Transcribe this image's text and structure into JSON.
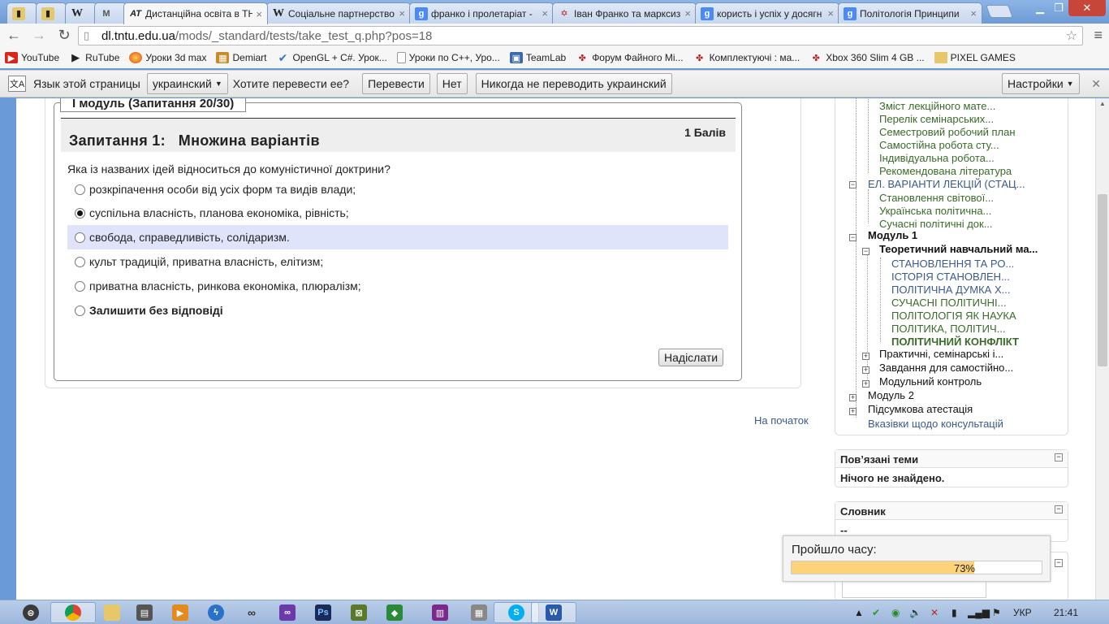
{
  "tabs": [
    {
      "label": "",
      "icon": "folder-icon",
      "color": "#d8b44a"
    },
    {
      "label": "",
      "icon": "folder-icon",
      "color": "#d8b44a"
    },
    {
      "label": "W",
      "icon": "wikipedia-icon",
      "color": "#ffffff"
    },
    {
      "label": "M",
      "icon": "moodle-icon",
      "color": "#ffffff"
    },
    {
      "label": "Дистанційна освіта в ТН",
      "icon": "at-icon",
      "color": "#ffffff",
      "active": true
    },
    {
      "label": "Соціальне партнерство",
      "icon": "wikipedia-icon",
      "color": "#ffffff"
    },
    {
      "label": "франко і пролетаріат -",
      "icon": "google-icon",
      "color": "#4a8af4"
    },
    {
      "label": "Іван Франко та марксизм",
      "icon": "star-icon",
      "color": "#ffffff"
    },
    {
      "label": "користь і успіх у досягн",
      "icon": "google-icon",
      "color": "#4a8af4"
    },
    {
      "label": "Політологія Принципи",
      "icon": "google-icon",
      "color": "#4a8af4"
    }
  ],
  "address": {
    "host": "dl.tntu.edu.ua",
    "path": "/mods/_standard/tests/take_test_q.php?pos=18"
  },
  "bookmarks": [
    {
      "label": "YouTube",
      "icon": "youtube-icon",
      "color": "#d9261b"
    },
    {
      "label": "RuTube",
      "icon": "play-icon",
      "color": "#111111"
    },
    {
      "label": "Уроки 3d max",
      "icon": "ball-icon",
      "color": "#e8661c"
    },
    {
      "label": "Demiart",
      "icon": "demiart-icon",
      "color": "#c98a2a"
    },
    {
      "label": "OpenGL + C#. Урок...",
      "icon": "check-icon",
      "color": "#3a76c8"
    },
    {
      "label": "Уроки по C++, Уро...",
      "icon": "page-icon",
      "color": "#888888"
    },
    {
      "label": "TeamLab",
      "icon": "teamlab-icon",
      "color": "#3a6aa8"
    },
    {
      "label": "Форум Файного Мі...",
      "icon": "forum-icon",
      "color": "#b52222"
    },
    {
      "label": "Комплектуючі : ма...",
      "icon": "forum-icon",
      "color": "#b52222"
    },
    {
      "label": "Xbox 360 Slim 4 GB ...",
      "icon": "forum-icon",
      "color": "#b52222"
    },
    {
      "label": "PIXEL GAMES",
      "icon": "folder-icon",
      "color": "#e0b94a"
    }
  ],
  "translate": {
    "prompt": "Язык этой страницы",
    "language": "украинский",
    "question": "Хотите перевести ее?",
    "translate_btn": "Перевести",
    "no_btn": "Нет",
    "never_btn": "Никогда не переводить украинский",
    "settings_btn": "Настройки"
  },
  "test": {
    "module": "І модуль (Запитання 20/30)",
    "question_title": "Запитання 1:   Множина варіантів",
    "points": "1 Балів",
    "question_text": "Яка із названих ідей відноситься до комуністичної доктрини?",
    "options": [
      {
        "text": "розкріпачення особи від усіх форм та видів влади;",
        "selected": false,
        "highlight": false
      },
      {
        "text": "суспільна власність, планова економіка, рівність;",
        "selected": true,
        "highlight": false
      },
      {
        "text": "свобода, справедливість, солідаризм.",
        "selected": false,
        "highlight": true
      },
      {
        "text": "культ традицій, приватна власність, елітизм;",
        "selected": false,
        "highlight": false
      },
      {
        "text": "приватна власність, ринкова економіка, плюралізм;",
        "selected": false,
        "highlight": false
      },
      {
        "text": "Залишити без відповіді",
        "selected": false,
        "highlight": false,
        "bold": true
      }
    ],
    "submit": "Надіслати",
    "to_top": "На початок"
  },
  "nav": {
    "items_top": [
      "Зміст лекційного мате...",
      "Перелік семінарських...",
      "Семестровий робочий план",
      "Самостійна робота сту...",
      "Індивідуальна робота...",
      "Рекомендована література"
    ],
    "lectures": "ЕЛ. ВАРІАНТИ ЛЕКЦІЙ (СТАЦ...",
    "lecture_items": [
      "Становлення світової...",
      "Українська політична...",
      "Сучасні політичні док..."
    ],
    "module1": "Модуль 1",
    "theory": "Теоретичний навчальний ма...",
    "theory_items": [
      "СТАНОВЛЕННЯ ТА РО...",
      "ІСТОРІЯ СТАНОВЛЕН...",
      "ПОЛІТИЧНА ДУМКА Х...",
      "СУЧАСНІ ПОЛІТИЧНІ...",
      "ПОЛІТОЛОГІЯ ЯК НАУКА",
      "ПОЛІТИКА, ПОЛІТИЧ..."
    ],
    "theory_current": "ПОЛІТИЧНИЙ КОНФЛІКТ",
    "after": [
      "Практичні, семінарські і...",
      "Завдання для самостійно...",
      "Модульний контроль"
    ],
    "module2": "Модуль 2",
    "final": "Підсумкова атестація",
    "consult": "Вказівки щодо консультацій"
  },
  "related": {
    "title": "Пов’язані теми",
    "body": "Нічого не знайдено."
  },
  "glossary": {
    "title": "Словник",
    "body": "--"
  },
  "timer": {
    "label": "Пройшло часу:",
    "percent": 73,
    "percent_text": "73%"
  },
  "tray": {
    "lang": "УКР",
    "time": "21:41"
  }
}
